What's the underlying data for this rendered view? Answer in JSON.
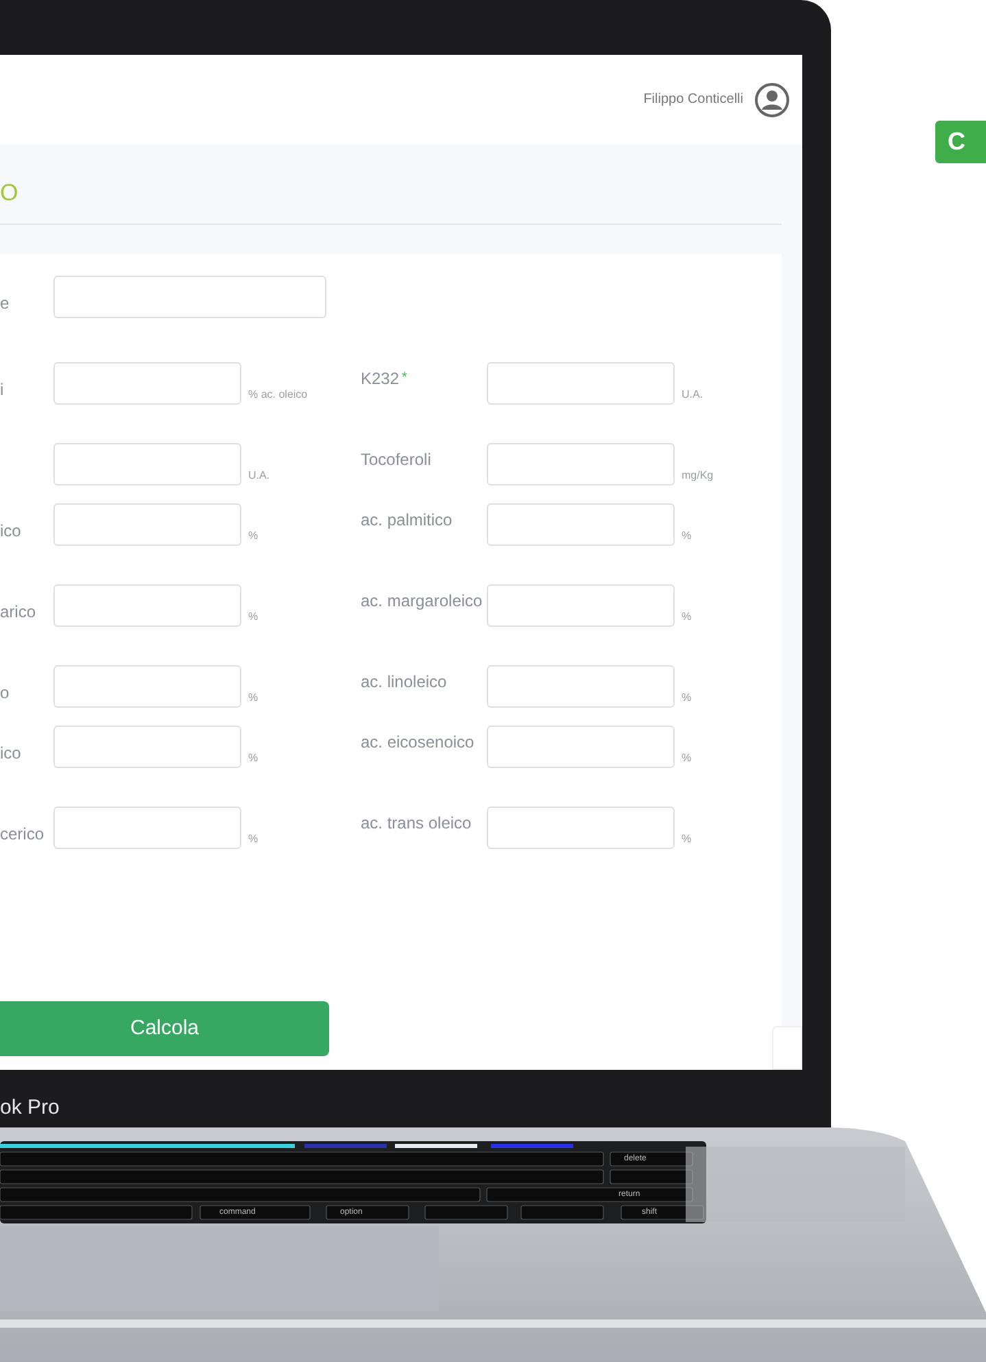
{
  "header": {
    "user_name": "Filippo Conticelli"
  },
  "page_title": "O",
  "side_button": {
    "label": "C"
  },
  "form_rows": [
    {
      "left": {
        "label": "e"
      }
    },
    {
      "left": {
        "label": "i",
        "unit": "% ac. oleico"
      },
      "right": {
        "label": "K232",
        "required_mark": "*",
        "unit": "U.A."
      }
    },
    {
      "left": {
        "unit": "U.A."
      },
      "right": {
        "label": "Tocoferoli",
        "unit": "mg/Kg"
      }
    },
    {
      "left": {
        "label": "ico",
        "unit": "%"
      },
      "right": {
        "label": "ac. palmitico",
        "unit": "%"
      }
    },
    {
      "left": {
        "label": "arico",
        "unit": "%"
      },
      "right": {
        "label": "ac. margaroleico",
        "unit": "%"
      }
    },
    {
      "left": {
        "label": "o",
        "unit": "%"
      },
      "right": {
        "label": "ac. linoleico",
        "unit": "%"
      }
    },
    {
      "left": {
        "label": "ico",
        "unit": "%"
      },
      "right": {
        "label": "ac. eicosenoico",
        "unit": "%"
      }
    },
    {
      "left": {
        "label": "cerico",
        "unit": "%"
      },
      "right": {
        "label": "ac. trans oleico",
        "unit": "%"
      }
    }
  ],
  "submit_button": {
    "label": "Calcola"
  },
  "laptop_label": "ok Pro",
  "keyboard_keys": [
    {
      "label": "delete"
    },
    {
      "label": "return"
    },
    {
      "label": "command"
    },
    {
      "label": "option"
    },
    {
      "label": "shift"
    }
  ]
}
